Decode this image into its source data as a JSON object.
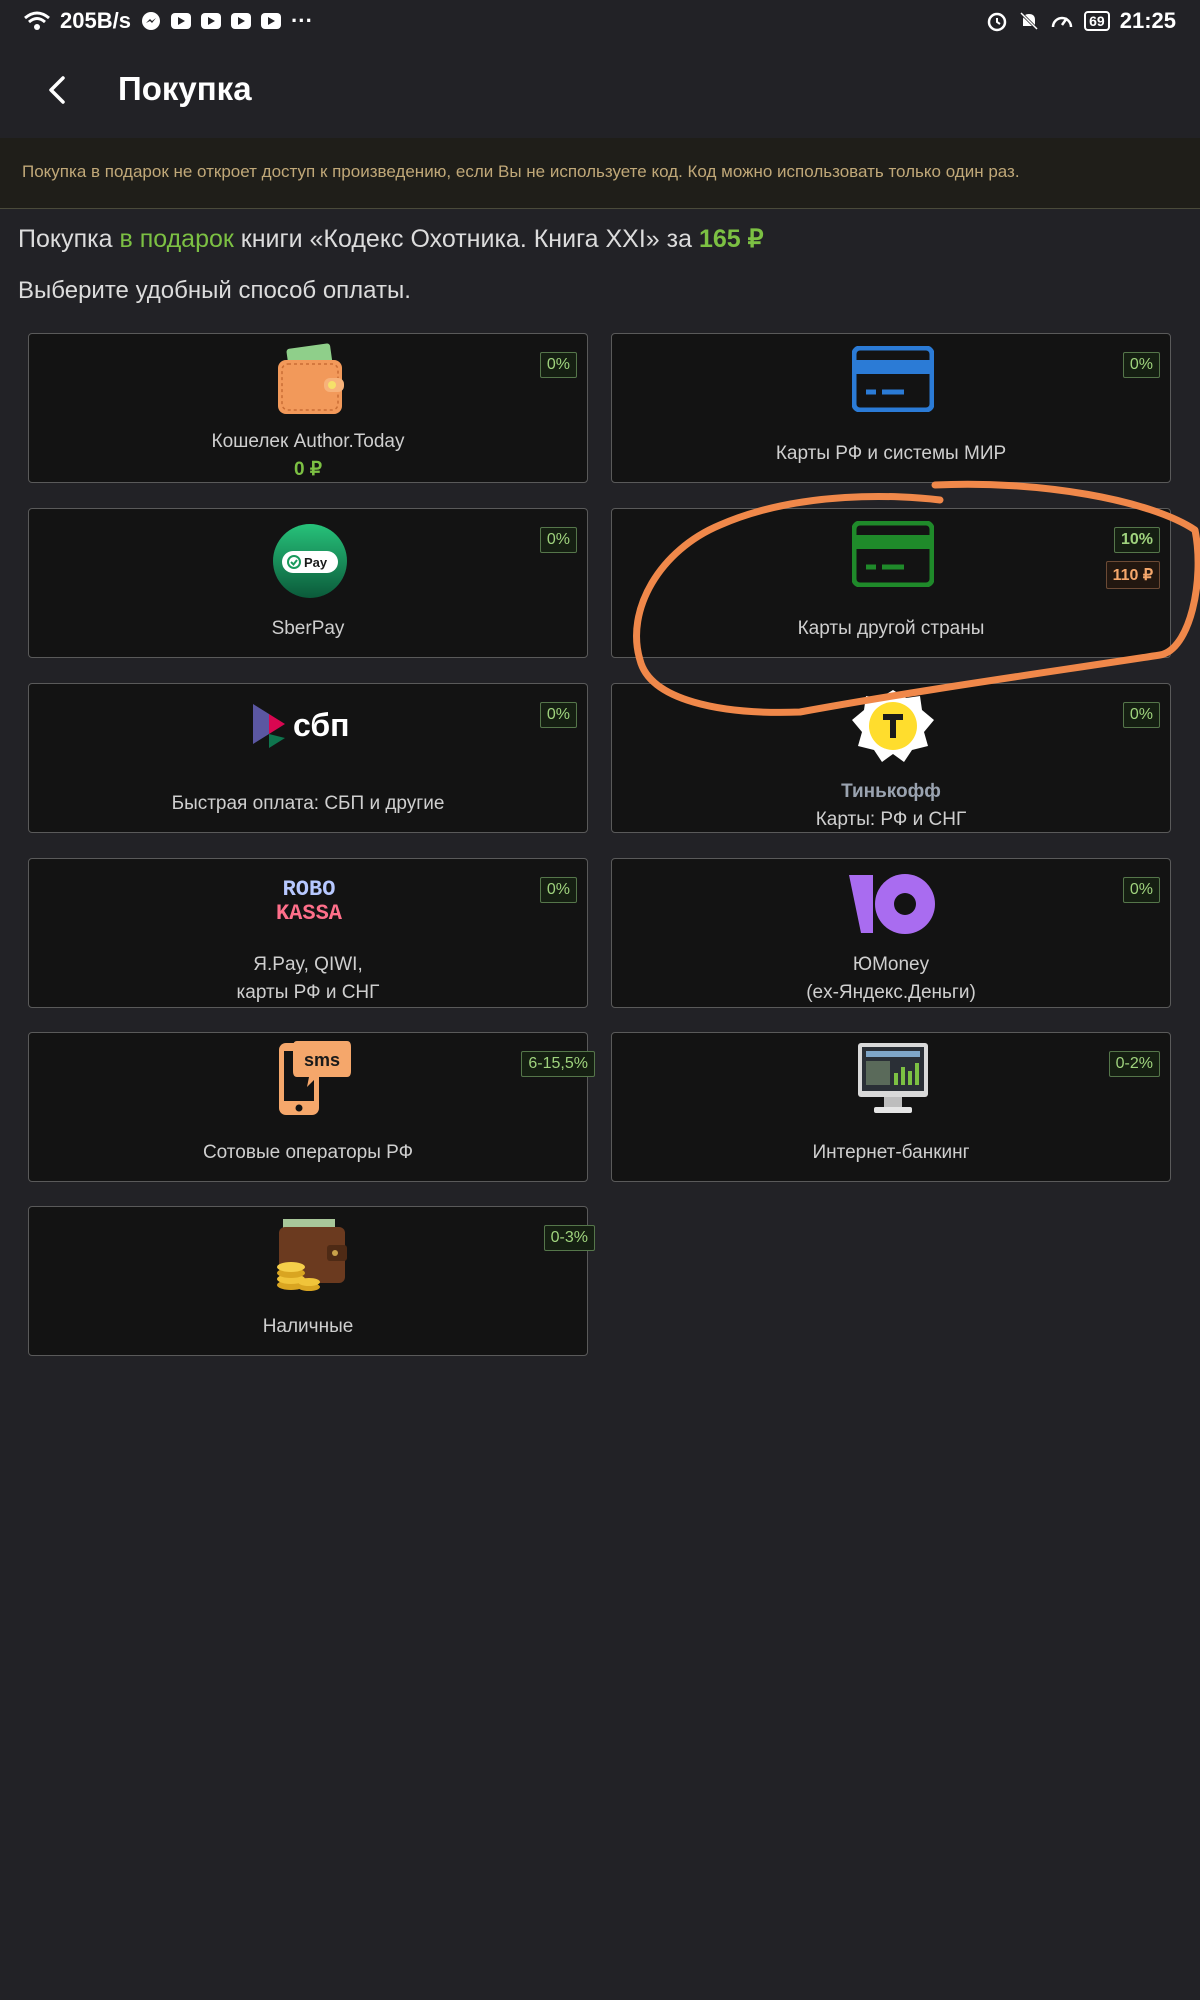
{
  "status_bar": {
    "speed": "205B/s",
    "battery": "69",
    "time": "21:25",
    "icons": [
      "wifi-icon",
      "messenger-icon",
      "youtube-icon",
      "youtube-icon",
      "youtube-icon",
      "youtube-icon",
      "more-icon",
      "alarm-icon",
      "mute-icon",
      "speed-icon",
      "battery-icon"
    ]
  },
  "header": {
    "title": "Покупка"
  },
  "notice": {
    "text": "Покупка в подарок не откроет доступ к произведению, если Вы не используете код. Код можно использовать только один раз."
  },
  "purchase": {
    "prefix": "Покупка ",
    "gift_label": "в подарок",
    "middle": " книги «Кодекс Охотника. Книга XXI» за ",
    "price": "165 ₽",
    "instruction": "Выберите удобный способ оплаты."
  },
  "payment_methods": [
    {
      "id": "wallet",
      "label": "Кошелек Author.Today",
      "sub": "0 ₽",
      "badge": "0%",
      "icon": "wallet-icon"
    },
    {
      "id": "cards-ru",
      "label": "Карты РФ и системы МИР",
      "badge": "0%",
      "icon": "card-blue-icon"
    },
    {
      "id": "sberpay",
      "label": "SberPay",
      "badge": "0%",
      "icon": "sberpay-icon",
      "icon_text": "Pay"
    },
    {
      "id": "cards-foreign",
      "label": "Карты другой страны",
      "badge": "10%",
      "extra_badge": "110 ₽",
      "icon": "card-green-icon"
    },
    {
      "id": "sbp",
      "label": "Быстрая оплата: СБП и другие",
      "badge": "0%",
      "icon": "sbp-icon",
      "icon_text": "сбп"
    },
    {
      "id": "tinkoff",
      "label_bold": "Тинькофф",
      "label": "Карты: РФ и СНГ",
      "badge": "0%",
      "icon": "tinkoff-icon"
    },
    {
      "id": "robokassa",
      "label_line1": "Я.Pay, QIWI,",
      "label_line2": "карты РФ и СНГ",
      "badge": "0%",
      "icon": "robokassa-icon",
      "icon_text1": "ROBO",
      "icon_text2": "KASSA"
    },
    {
      "id": "yoomoney",
      "label_line1": "ЮMoney",
      "label_line2": "(ex-Яндекс.Деньги)",
      "badge": "0%",
      "icon": "yoomoney-icon"
    },
    {
      "id": "mobile",
      "label": "Сотовые операторы РФ",
      "badge": "6-15,5%",
      "icon": "sms-phone-icon",
      "icon_text": "sms"
    },
    {
      "id": "ibank",
      "label": "Интернет-банкинг",
      "badge": "0-2%",
      "icon": "monitor-icon"
    },
    {
      "id": "cash",
      "label": "Наличные",
      "badge": "0-3%",
      "icon": "cash-wallet-icon"
    }
  ],
  "colors": {
    "background": "#222226",
    "card": "#131313",
    "accent_green": "#7cc043",
    "annotation": "#f0884a"
  }
}
